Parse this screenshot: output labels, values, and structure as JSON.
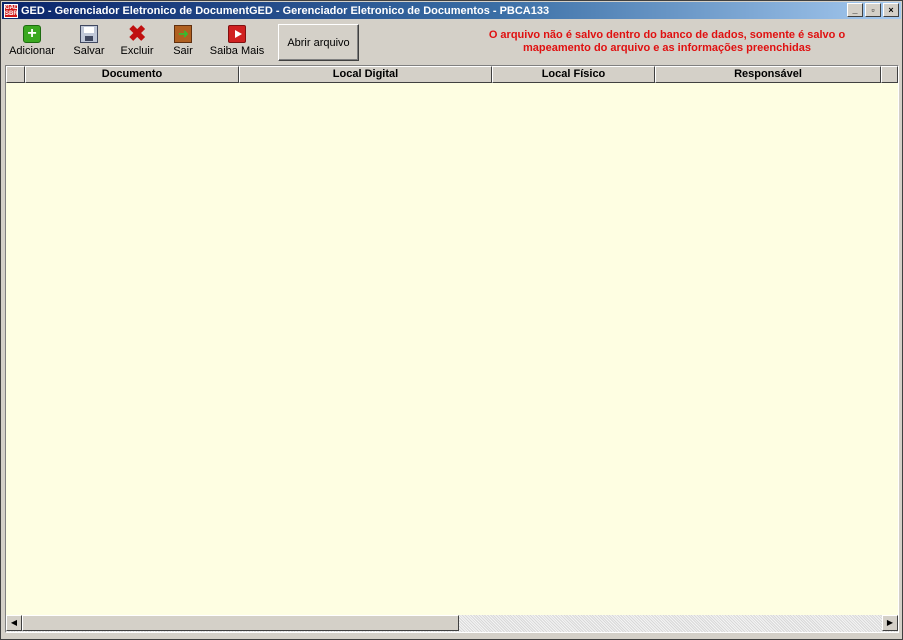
{
  "window": {
    "title": "GED - Gerenciador Eletronico de DocumentGED - Gerenciador Eletronico de Documentos - PBCA133",
    "icon_text": "GAD SBR",
    "controls": {
      "minimize": "_",
      "restore": "▫",
      "close": "×"
    }
  },
  "toolbar": {
    "items": [
      {
        "label": "Adicionar",
        "icon": "add-icon"
      },
      {
        "label": "Salvar",
        "icon": "save-icon"
      },
      {
        "label": "Excluir",
        "icon": "delete-icon"
      },
      {
        "label": "Sair",
        "icon": "exit-icon"
      },
      {
        "label": "Saiba Mais",
        "icon": "info-play-icon"
      }
    ],
    "open_file_label": "Abrir arquivo"
  },
  "notice": {
    "line1": "O arquivo não é salvo dentro do banco de dados, somente é salvo o",
    "line2": "mapeamento do arquivo e as informações preenchidas",
    "color": "#e01010"
  },
  "grid": {
    "columns": [
      "",
      "Documento",
      "Local Digital",
      "Local Físico",
      "Responsável",
      ""
    ],
    "rows": [],
    "background": "#fefee2"
  },
  "scrollbar": {
    "left": "◀",
    "right": "▶"
  }
}
